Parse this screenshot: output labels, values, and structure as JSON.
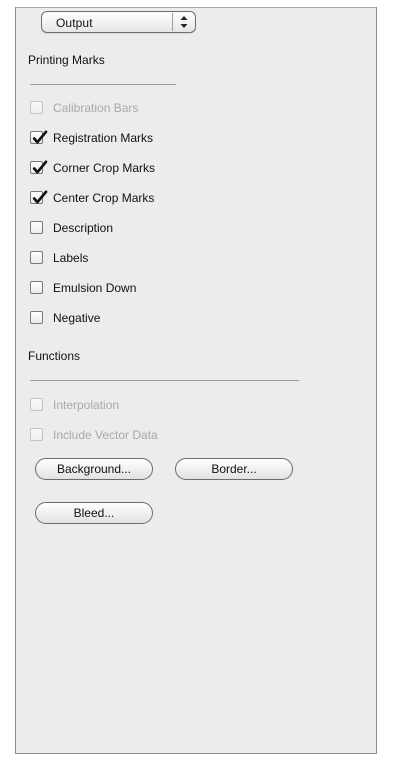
{
  "output_menu": {
    "value": "Output",
    "arrows_icon": "up-down-arrows-icon"
  },
  "printing_marks": {
    "title": "Printing Marks",
    "items": [
      {
        "label": "Calibration Bars",
        "checked": false,
        "enabled": false
      },
      {
        "label": "Registration Marks",
        "checked": true,
        "enabled": true
      },
      {
        "label": "Corner Crop Marks",
        "checked": true,
        "enabled": true
      },
      {
        "label": "Center Crop Marks",
        "checked": true,
        "enabled": true
      },
      {
        "label": "Description",
        "checked": false,
        "enabled": true
      },
      {
        "label": "Labels",
        "checked": false,
        "enabled": true
      },
      {
        "label": "Emulsion Down",
        "checked": false,
        "enabled": true
      },
      {
        "label": "Negative",
        "checked": false,
        "enabled": true
      }
    ]
  },
  "functions": {
    "title": "Functions",
    "items": [
      {
        "label": "Interpolation",
        "checked": false,
        "enabled": false
      },
      {
        "label": "Include Vector Data",
        "checked": false,
        "enabled": false
      }
    ],
    "buttons": {
      "background": "Background...",
      "border": "Border...",
      "bleed": "Bleed..."
    }
  },
  "colors": {
    "panel_background": "#ececec",
    "text": "#111111",
    "disabled_text": "#a9a9a9",
    "border": "#7a7a7a"
  }
}
